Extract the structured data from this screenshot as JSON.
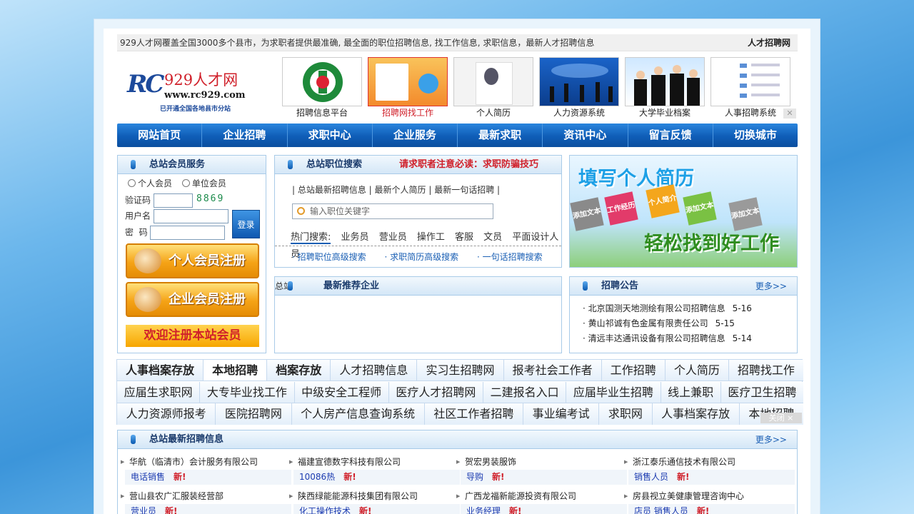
{
  "topbar": {
    "text": "929人才网覆盖全国3000多个县市，为求职者提供最准确, 最全面的职位招聘信息, 找工作信息, 求职信息，最新人才招聘信息",
    "right": "人才招聘网"
  },
  "logo": {
    "mark": "RC",
    "name": "929人才网",
    "url": "www.rc929.com",
    "sub": "已开通全国各地县市分站"
  },
  "ads": [
    {
      "label": "招聘信息平台"
    },
    {
      "label": "招聘网找工作",
      "highlight": true
    },
    {
      "label": "个人简历"
    },
    {
      "label": "人力资源系统"
    },
    {
      "label": "大学毕业档案"
    },
    {
      "label": "人事招聘系统"
    }
  ],
  "nav": [
    "网站首页",
    "企业招聘",
    "求职中心",
    "企业服务",
    "最新求职",
    "资讯中心",
    "留言反馈",
    "切换城市"
  ],
  "member": {
    "title": "总站会员服务",
    "radio_personal": "个人会员",
    "radio_company": "单位会员",
    "captcha_label": "验证码",
    "captcha_code": "8869",
    "user_label": "用户名",
    "pass_label": "密  码",
    "login": "登录",
    "reg_personal": "个人会员注册",
    "reg_company": "企业会员注册",
    "welcome": "欢迎注册本站会员"
  },
  "search": {
    "title": "总站职位搜索",
    "warning": "请求职者注意必读：求职防骗技巧",
    "links": "| 总站最新招聘信息  |  最新个人简历  |  最新一句话招聘  |",
    "placeholder": "输入职位关键字",
    "hot_label": "热门搜索:",
    "hot": [
      "业务员",
      "营业员",
      "操作工",
      "客服",
      "文员",
      "平面设计人员"
    ],
    "adv": [
      "· 招聘职位高级搜索",
      "· 求职简历高级搜索",
      "· 一句话招聘搜索"
    ]
  },
  "banner": {
    "line1": "填写个人简历",
    "line2": "轻松找到好工作",
    "cubes": [
      "添加文本",
      "工作经历",
      "个人简介",
      "添加文本",
      "添加文本"
    ]
  },
  "recent": {
    "prefix": "总站",
    "title": "最新推荐企业"
  },
  "notice": {
    "title": "招聘公告",
    "more": "更多>>",
    "items": [
      {
        "text": "· 北京国测天地测绘有限公司招聘信息",
        "date": "5-16"
      },
      {
        "text": "· 黄山祁诚有色金属有限责任公司",
        "date": "5-15"
      },
      {
        "text": "· 清远丰达通讯设备有限公司招聘信息",
        "date": "5-14"
      }
    ]
  },
  "links": [
    [
      "人事档案存放",
      "本地招聘",
      "档案存放",
      "人才招聘信息",
      "实习生招聘网",
      "报考社会工作者",
      "工作招聘",
      "个人简历",
      "招聘找工作"
    ],
    [
      "应届生求职网",
      "大专毕业找工作",
      "中级安全工程师",
      "医疗人才招聘网",
      "二建报名入口",
      "应届毕业生招聘",
      "线上兼职",
      "医疗卫生招聘"
    ],
    [
      "人力资源师报考",
      "医院招聘网",
      "个人房产信息查询系统",
      "社区工作者招聘",
      "事业编考试",
      "求职网",
      "人事档案存放",
      "本地招聘"
    ]
  ],
  "adclose": "关闭 ×",
  "jobs": {
    "title": "总站最新招聘信息",
    "more": "更多>>",
    "new_label": "新!",
    "cols": [
      [
        {
          "company": "华航（临清市）会计服务有限公司",
          "position": "电话销售"
        },
        {
          "company": "营山县农广汇服装经营部",
          "position": "营业员"
        }
      ],
      [
        {
          "company": "福建宣德数字科技有限公司",
          "position": "10086热"
        },
        {
          "company": "陕西绿能能源科技集团有限公司",
          "position": "化工操作技术"
        }
      ],
      [
        {
          "company": "贺宏男装服饰",
          "position": "导购"
        },
        {
          "company": "广西龙福新能源投资有限公司",
          "position": "业务经理"
        }
      ],
      [
        {
          "company": "浙江泰乐通信技术有限公司",
          "position": "销售人员"
        },
        {
          "company": "房县视立美健康管理咨询中心",
          "position": "店员  销售人员"
        }
      ]
    ]
  }
}
